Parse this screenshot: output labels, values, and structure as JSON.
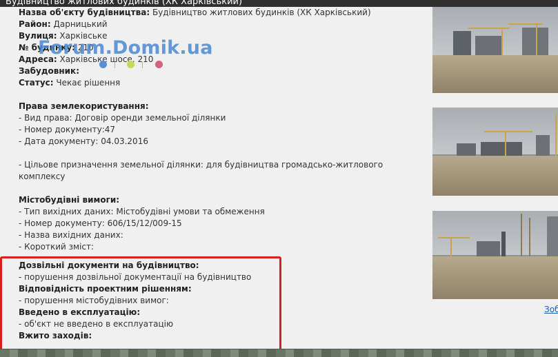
{
  "popup": {
    "title": "Будівництво житлових будинків (ХК Харківський)"
  },
  "watermark": {
    "text": "Forum.Domik.ua",
    "dot_colors": [
      "#5a8fd6",
      "#c8d65a",
      "#d6617a"
    ]
  },
  "info": {
    "object_label": "Назва об'єкту будівництва:",
    "object_value": "Будівництво житлових будинків (ХК Харківський)",
    "district_label": "Район:",
    "district_value": "Дарницький",
    "street_label": "Вулиця:",
    "street_value": "Харківське",
    "building_label": "№ будинку:",
    "building_value": "210",
    "address_label": "Адреса:",
    "address_value": "Харківське шосе, 210",
    "developer_label": "Забудовник:",
    "developer_value": "",
    "status_label": "Статус:",
    "status_value": "Чекає рішення"
  },
  "land_rights": {
    "heading": "Права землекористування:",
    "type": "- Вид права: Договір оренди земельної ділянки",
    "doc_number": "- Номер документу:47",
    "doc_date": "- Дата документу:  04.03.2016",
    "purpose": "- Цільове призначення земельної ділянки: для будівництва громадсько-житлового комплексу"
  },
  "urban_requirements": {
    "heading": "Містобудівні вимоги:",
    "type": "- Тип вихідних даних: Містобудівні умови та обмеження",
    "doc_number": "- Номер документу:        606/15/12/009-15",
    "name": "- Назва вихідних даних:",
    "summary": "- Короткий зміст:"
  },
  "permits": {
    "heading": "Дозвільні документи на будівництво:",
    "value": "- порушення дозвільної документації на будівництво",
    "compliance_heading": "Відповідність проектним рішенням:",
    "compliance_value": "- порушення містобудівних вимог:",
    "operation_heading": "Введено в експлуатацію:",
    "operation_value": "- об'єкт не введено в експлуатацію",
    "measures_heading": "Вжито заходів:"
  },
  "gallery": {
    "more_link": "Зоб"
  },
  "colors": {
    "highlight": "#d42020",
    "link": "#1a5fb4",
    "title_bar": "#2f2f2f"
  }
}
